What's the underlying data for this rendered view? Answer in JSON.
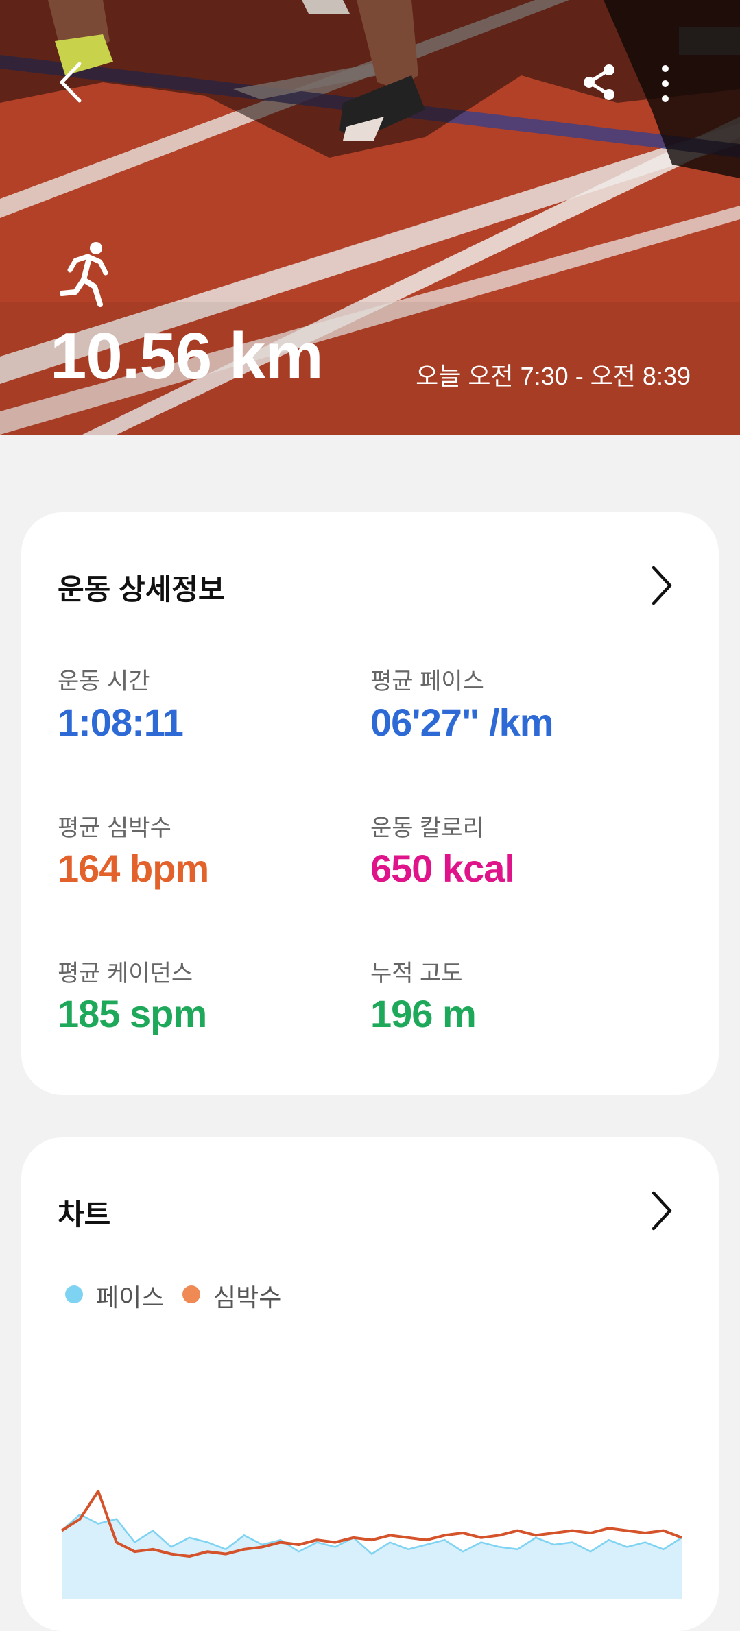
{
  "hero": {
    "distance": "10.56 km",
    "time_range": "오늘 오전 7:30 - 오전 8:39",
    "activity_icon": "running-icon"
  },
  "header_icons": {
    "back": "chevron-left-icon",
    "share": "share-icon",
    "more": "more-vertical-icon"
  },
  "details": {
    "title": "운동 상세정보",
    "stats": [
      {
        "label": "운동 시간",
        "value": "1:08:11",
        "color": "#2e6ad6"
      },
      {
        "label": "평균 페이스",
        "value": "06'27\" /km",
        "color": "#2e6ad6"
      },
      {
        "label": "평균 심박수",
        "value": "164 bpm",
        "color": "#e3622b"
      },
      {
        "label": "운동 칼로리",
        "value": "650 kcal",
        "color": "#e0148a"
      },
      {
        "label": "평균 케이던스",
        "value": "185 spm",
        "color": "#1ea85a"
      },
      {
        "label": "누적 고도",
        "value": "196 m",
        "color": "#1ea85a"
      }
    ]
  },
  "chart": {
    "title": "차트",
    "legend": [
      {
        "label": "페이스",
        "color": "#7fd3f2"
      },
      {
        "label": "심박수",
        "color": "#f08a55"
      }
    ]
  },
  "chart_data": {
    "type": "line",
    "x": [
      0,
      2,
      4,
      6,
      8,
      10,
      12,
      14,
      16,
      18,
      20,
      22,
      24,
      26,
      28,
      30,
      32,
      34,
      36,
      38,
      40,
      42,
      44,
      46,
      48,
      50,
      52,
      54,
      56,
      58,
      60,
      62,
      64,
      66,
      68
    ],
    "series": [
      {
        "name": "페이스",
        "values": [
          0.55,
          0.62,
          0.58,
          0.6,
          0.5,
          0.55,
          0.48,
          0.52,
          0.5,
          0.47,
          0.53,
          0.49,
          0.51,
          0.46,
          0.5,
          0.48,
          0.52,
          0.45,
          0.5,
          0.47,
          0.49,
          0.51,
          0.46,
          0.5,
          0.48,
          0.47,
          0.52,
          0.49,
          0.5,
          0.46,
          0.51,
          0.48,
          0.5,
          0.47,
          0.52
        ],
        "style": "area"
      },
      {
        "name": "심박수",
        "values": [
          0.55,
          0.6,
          0.72,
          0.5,
          0.46,
          0.47,
          0.45,
          0.44,
          0.46,
          0.45,
          0.47,
          0.48,
          0.5,
          0.49,
          0.51,
          0.5,
          0.52,
          0.51,
          0.53,
          0.52,
          0.51,
          0.53,
          0.54,
          0.52,
          0.53,
          0.55,
          0.53,
          0.54,
          0.55,
          0.54,
          0.56,
          0.55,
          0.54,
          0.55,
          0.52
        ]
      }
    ],
    "grid": false,
    "legend_position": "top-left"
  }
}
